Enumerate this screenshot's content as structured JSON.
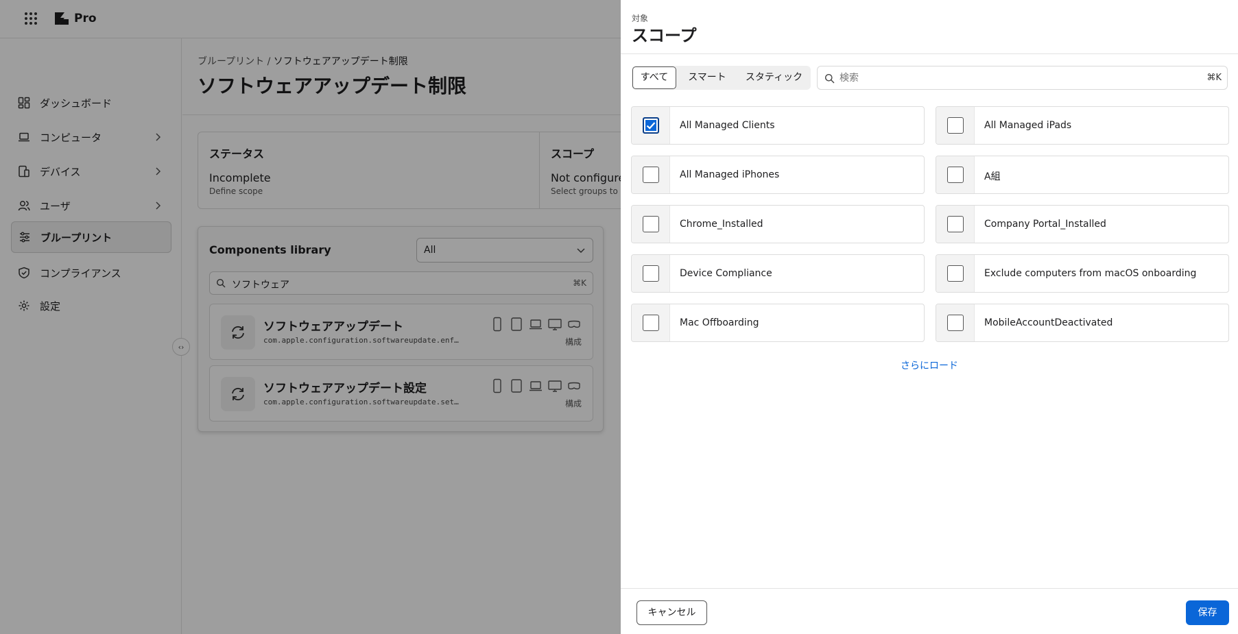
{
  "app": {
    "brand": "Pro"
  },
  "sidebar": {
    "items": [
      {
        "label": "ダッシュボード",
        "icon": "dashboard-icon",
        "has_children": false,
        "active": false
      },
      {
        "label": "コンピュータ",
        "icon": "laptop-icon",
        "has_children": true,
        "active": false
      },
      {
        "label": "デバイス",
        "icon": "devices-icon",
        "has_children": true,
        "active": false
      },
      {
        "label": "ユーザ",
        "icon": "users-icon",
        "has_children": true,
        "active": false
      },
      {
        "label": "ブループリント",
        "icon": "sliders-icon",
        "has_children": false,
        "active": true
      },
      {
        "label": "コンプライアンス",
        "icon": "shield-check-icon",
        "has_children": false,
        "active": false
      },
      {
        "label": "設定",
        "icon": "gear-icon",
        "has_children": false,
        "active": false
      }
    ]
  },
  "main": {
    "breadcrumb_parent": "ブループリント",
    "breadcrumb_sep": " / ",
    "breadcrumb_current": "ソフトウェアアップデート制限",
    "title": "ソフトウェアアップデート制限",
    "status": {
      "heading": "ステータス",
      "value": "Incomplete",
      "sub": "Define scope"
    },
    "scope": {
      "heading": "スコープ",
      "value": "Not configured",
      "sub": "Select groups to be"
    },
    "library": {
      "title": "Components library",
      "filter_value": "All",
      "search_value": "ソフトウェア",
      "search_shortcut": "⌘K",
      "components": [
        {
          "name": "ソフトウェアアップデート",
          "id": "com.apple.configuration.softwareupdate.enforcement",
          "tag": "構成"
        },
        {
          "name": "ソフトウェアアップデート設定",
          "id": "com.apple.configuration.softwareupdate.settings",
          "tag": "構成"
        }
      ]
    }
  },
  "drawer": {
    "supertitle": "対象",
    "title": "スコープ",
    "tabs": [
      {
        "label": "すべて",
        "selected": true
      },
      {
        "label": "スマート",
        "selected": false
      },
      {
        "label": "スタティック",
        "selected": false
      }
    ],
    "search": {
      "placeholder": "検索",
      "value": "",
      "shortcut": "⌘K"
    },
    "options": [
      {
        "label": "All Managed Clients",
        "checked": true
      },
      {
        "label": "All Managed iPads",
        "checked": false
      },
      {
        "label": "All Managed iPhones",
        "checked": false
      },
      {
        "label": "A組",
        "checked": false
      },
      {
        "label": "Chrome_Installed",
        "checked": false
      },
      {
        "label": "Company Portal_Installed",
        "checked": false
      },
      {
        "label": "Device Compliance",
        "checked": false
      },
      {
        "label": "Exclude computers from macOS onboarding",
        "checked": false
      },
      {
        "label": "Mac Offboarding",
        "checked": false
      },
      {
        "label": "MobileAccountDeactivated",
        "checked": false
      }
    ],
    "load_more": "さらにロード",
    "cancel_label": "キャンセル",
    "save_label": "保存"
  },
  "colors": {
    "accent": "#0a66d8",
    "overlay": "rgba(0,0,0,0.38)"
  }
}
